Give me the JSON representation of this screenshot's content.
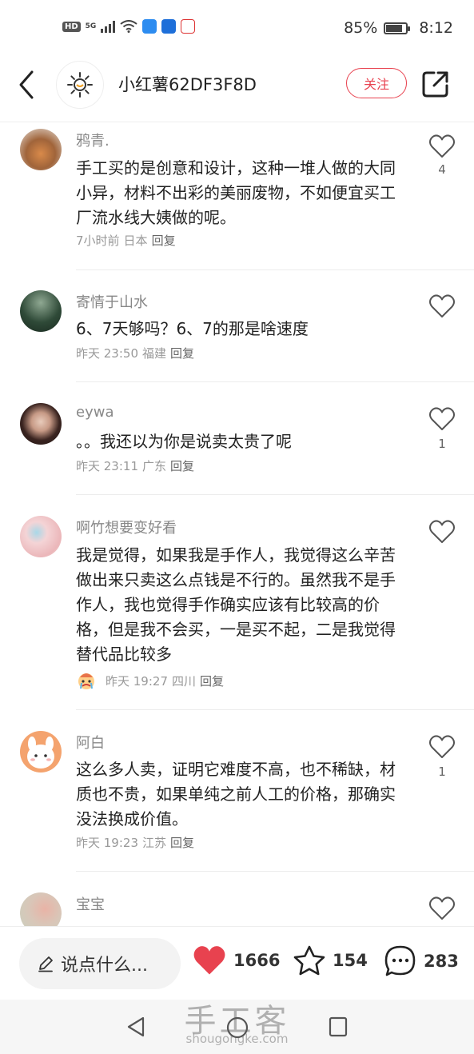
{
  "status_bar": {
    "network_badge": "HD",
    "signal_label": "5G",
    "battery_percent": "85%",
    "battery_level": 0.85,
    "time": "8:12"
  },
  "header": {
    "username": "小红薯62DF3F8D",
    "follow_label": "关注",
    "avatar_icon": "sun-icon"
  },
  "comments": [
    {
      "user": "鸦青.",
      "text": "手工买的是创意和设计，这种一堆人做的大同小异，材料不出彩的美丽废物，不如便宜买工厂流水线大姨做的呢。",
      "time": "7小时前",
      "location": "日本",
      "reply": "回复",
      "likes": "4",
      "avatar_color": "#a0643a"
    },
    {
      "user": "寄情于山水",
      "text": "6、7天够吗？6、7的那是啥速度",
      "time": "昨天 23:50",
      "location": "福建",
      "reply": "回复",
      "likes": "",
      "avatar_color": "#2f4a38"
    },
    {
      "user": "eywa",
      "text": "。。我还以为你是说卖太贵了呢",
      "time": "昨天 23:11",
      "location": "广东",
      "reply": "回复",
      "likes": "1",
      "avatar_color": "#5a3a34"
    },
    {
      "user": "啊竹想要变好看",
      "text": "我是觉得，如果我是手作人，我觉得这么辛苦做出来只卖这么点钱是不行的。虽然我不是手作人，我也觉得手作确实应该有比较高的价格，但是我不会买，一是买不起，二是我觉得替代品比较多",
      "time": "昨天 19:27",
      "location": "四川",
      "reply": "回复",
      "likes": "",
      "avatar_color": "#f1c9cc"
    },
    {
      "user": "阿白",
      "text": "这么多人卖，证明它难度不高，也不稀缺，材质也不贵，如果单纯之前人工的价格，那确实没法换成价值。",
      "time": "昨天 19:23",
      "location": "江苏",
      "reply": "回复",
      "likes": "1",
      "avatar_color": "#f4a36e"
    },
    {
      "user": "宝宝",
      "text": "",
      "time": "",
      "location": "",
      "reply": "",
      "likes": "",
      "avatar_color": "#d9c6b8"
    }
  ],
  "bottom_bar": {
    "input_placeholder": "说点什么...",
    "like_count": "1666",
    "collect_count": "154",
    "comment_count": "283",
    "like_color": "#e8424f"
  },
  "watermark": {
    "title": "手工客",
    "url": "shougongke.com"
  }
}
